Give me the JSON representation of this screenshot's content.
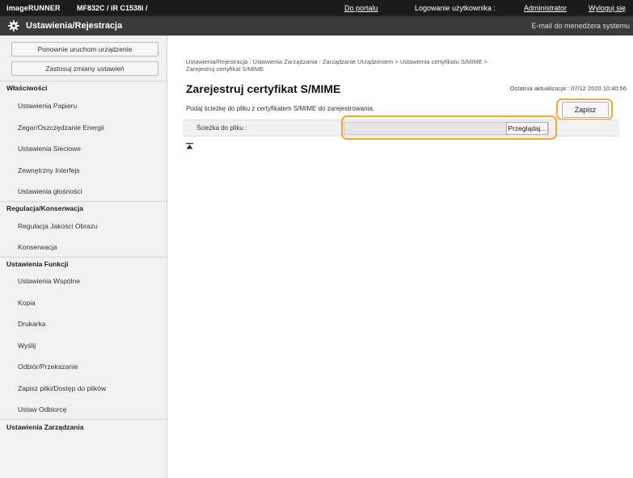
{
  "topbar": {
    "brand": "imageRUNNER",
    "model": "MF832C / iR C1538i /",
    "portal_link": "Do portalu",
    "logged_user_label": "Logowanie użytkownika :",
    "user_name": "Administrator",
    "logout_link": "Wyloguj się"
  },
  "titlebar": {
    "title": "Ustawienia/Rejestracja",
    "email_link": "E-mail do menedżera systemu"
  },
  "sidebar": {
    "restart_button": "Ponownie uruchom urządzenie",
    "apply_button": "Zastosuj zmiany ustawień",
    "sections": [
      {
        "title": "Właściwości",
        "items": [
          "Ustawienia Papieru",
          "Zegar/Oszczędzanie Energii",
          "Ustawienia Sieciowe",
          "Zewnętrzny Interfejs",
          "Ustawienia głośności"
        ]
      },
      {
        "title": "Regulacja/Konserwacja",
        "items": [
          "Regulacja Jakości Obrazu",
          "Konserwacja"
        ]
      },
      {
        "title": "Ustawienia Funkcji",
        "items": [
          "Ustawienia Wspólne",
          "Kopia",
          "Drukarka",
          "Wyślij",
          "Odbiór/Przekazanie",
          "Zapisz pliki/Dostęp do plików",
          "Ustaw Odbiorcę"
        ]
      },
      {
        "title": "Ustawienia Zarządzania",
        "items": []
      }
    ]
  },
  "main": {
    "breadcrumb_line1": "Ustawienia/Rejestracja : Ustawienia Zarządzania : Zarządzanie Urządzeniem > Ustawienia certyfikatu S/MIME >",
    "breadcrumb_line2": "Zarejestruj certyfikat S/MIME",
    "page_title": "Zarejestruj certyfikat S/MIME",
    "last_update": "Ostatnia aktualizacja : 07/12 2020 10:40:56",
    "description": "Podaj ścieżkę do pliku z certyfikatem S/MIME do zarejestrowania.",
    "save_button": "Zapisz",
    "file_path_label": "Ścieżka do pliku :",
    "file_path_value": "",
    "browse_button": "Przeglądaj..."
  },
  "colors": {
    "topbar_bg": "#1c1c1c",
    "titlebar_bg": "#3a3a3a",
    "highlight": "#f0a73a"
  },
  "icons": [
    "gear-icon",
    "back-to-top-icon"
  ]
}
